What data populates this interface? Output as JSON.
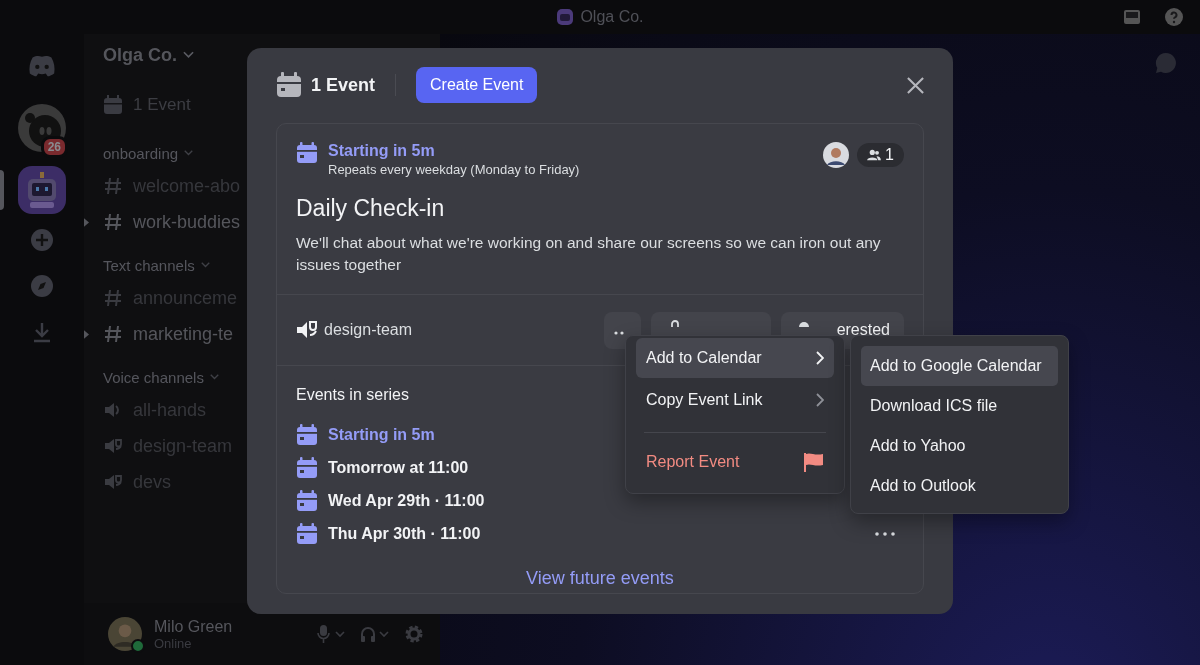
{
  "topbar": {
    "title": "Olga Co."
  },
  "servers": [
    {
      "kind": "logo",
      "selected": false
    },
    {
      "kind": "avatar",
      "badge": "26",
      "selected": false
    },
    {
      "kind": "bot",
      "selected": true
    },
    {
      "kind": "add",
      "selected": false
    },
    {
      "kind": "explore",
      "selected": false
    },
    {
      "kind": "download",
      "selected": false
    }
  ],
  "sidebar": {
    "server_name": "Olga Co.",
    "events_label": "1 Event",
    "groups": [
      {
        "name": "onboarding",
        "channels": [
          {
            "kind": "text",
            "name": "welcome-abo",
            "unread": false
          },
          {
            "kind": "text",
            "name": "work-buddies",
            "unread": true
          }
        ]
      },
      {
        "name": "Text channels",
        "channels": [
          {
            "kind": "text",
            "name": "announceme",
            "unread": false
          },
          {
            "kind": "text",
            "name": "marketing-te",
            "unread": true
          }
        ]
      },
      {
        "name": "Voice channels",
        "channels": [
          {
            "kind": "voice",
            "name": "all-hands",
            "unread": false
          },
          {
            "kind": "stage",
            "name": "design-team",
            "unread": false
          },
          {
            "kind": "stage",
            "name": "devs",
            "unread": false
          }
        ]
      }
    ]
  },
  "user": {
    "name": "Milo Green",
    "status": "Online"
  },
  "modal": {
    "title": "1 Event",
    "create_button": "Create Event",
    "event": {
      "status": "Starting in 5m",
      "repeat": "Repeats every weekday (Monday to Friday)",
      "interested_count": "1",
      "name": "Daily Check-in",
      "description": "We'll chat about what we're working on and share our screens so we can iron out any issues together",
      "channel": "design-team",
      "interested_button": "erested"
    },
    "series_title": "Events in series",
    "series": [
      {
        "label": "Starting in 5m",
        "current": true
      },
      {
        "label": "Tomorrow at 11:00",
        "current": false
      },
      {
        "label": "Wed Apr 29th · 11:00",
        "current": false
      },
      {
        "label": "Thu Apr 30th · 11:00",
        "current": false
      }
    ],
    "view_more": "View future events"
  },
  "menu": {
    "items": [
      {
        "kind": "submenu",
        "label": "Add to Calendar",
        "selected": true
      },
      {
        "kind": "submenu",
        "label": "Copy Event Link",
        "selected": false
      },
      {
        "kind": "danger",
        "label": "Report Event",
        "selected": false
      }
    ]
  },
  "submenu": {
    "items": [
      {
        "label": "Add to Google Calendar",
        "selected": true
      },
      {
        "label": "Download ICS file",
        "selected": false
      },
      {
        "label": "Add to Yahoo",
        "selected": false
      },
      {
        "label": "Add to Outlook",
        "selected": false
      }
    ]
  }
}
